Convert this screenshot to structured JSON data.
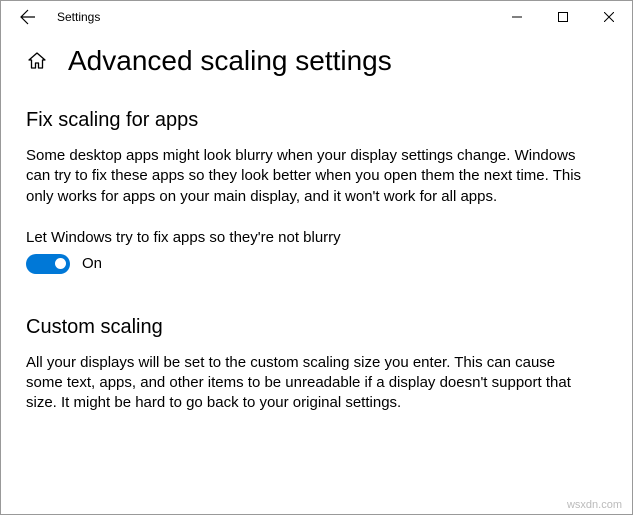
{
  "window": {
    "title": "Settings"
  },
  "page": {
    "title": "Advanced scaling settings"
  },
  "sections": {
    "fix_scaling": {
      "heading": "Fix scaling for apps",
      "description": "Some desktop apps might look blurry when your display settings change. Windows can try to fix these apps so they look better when you open them the next time. This only works for apps on your main display, and it won't work for all apps.",
      "toggle_label": "Let Windows try to fix apps so they're not blurry",
      "toggle_state": "On"
    },
    "custom_scaling": {
      "heading": "Custom scaling",
      "description": "All your displays will be set to the custom scaling size you enter. This can cause some text, apps, and other items to be unreadable if a display doesn't support that size. It might be hard to go back to your original settings."
    }
  },
  "watermark": "wsxdn.com"
}
